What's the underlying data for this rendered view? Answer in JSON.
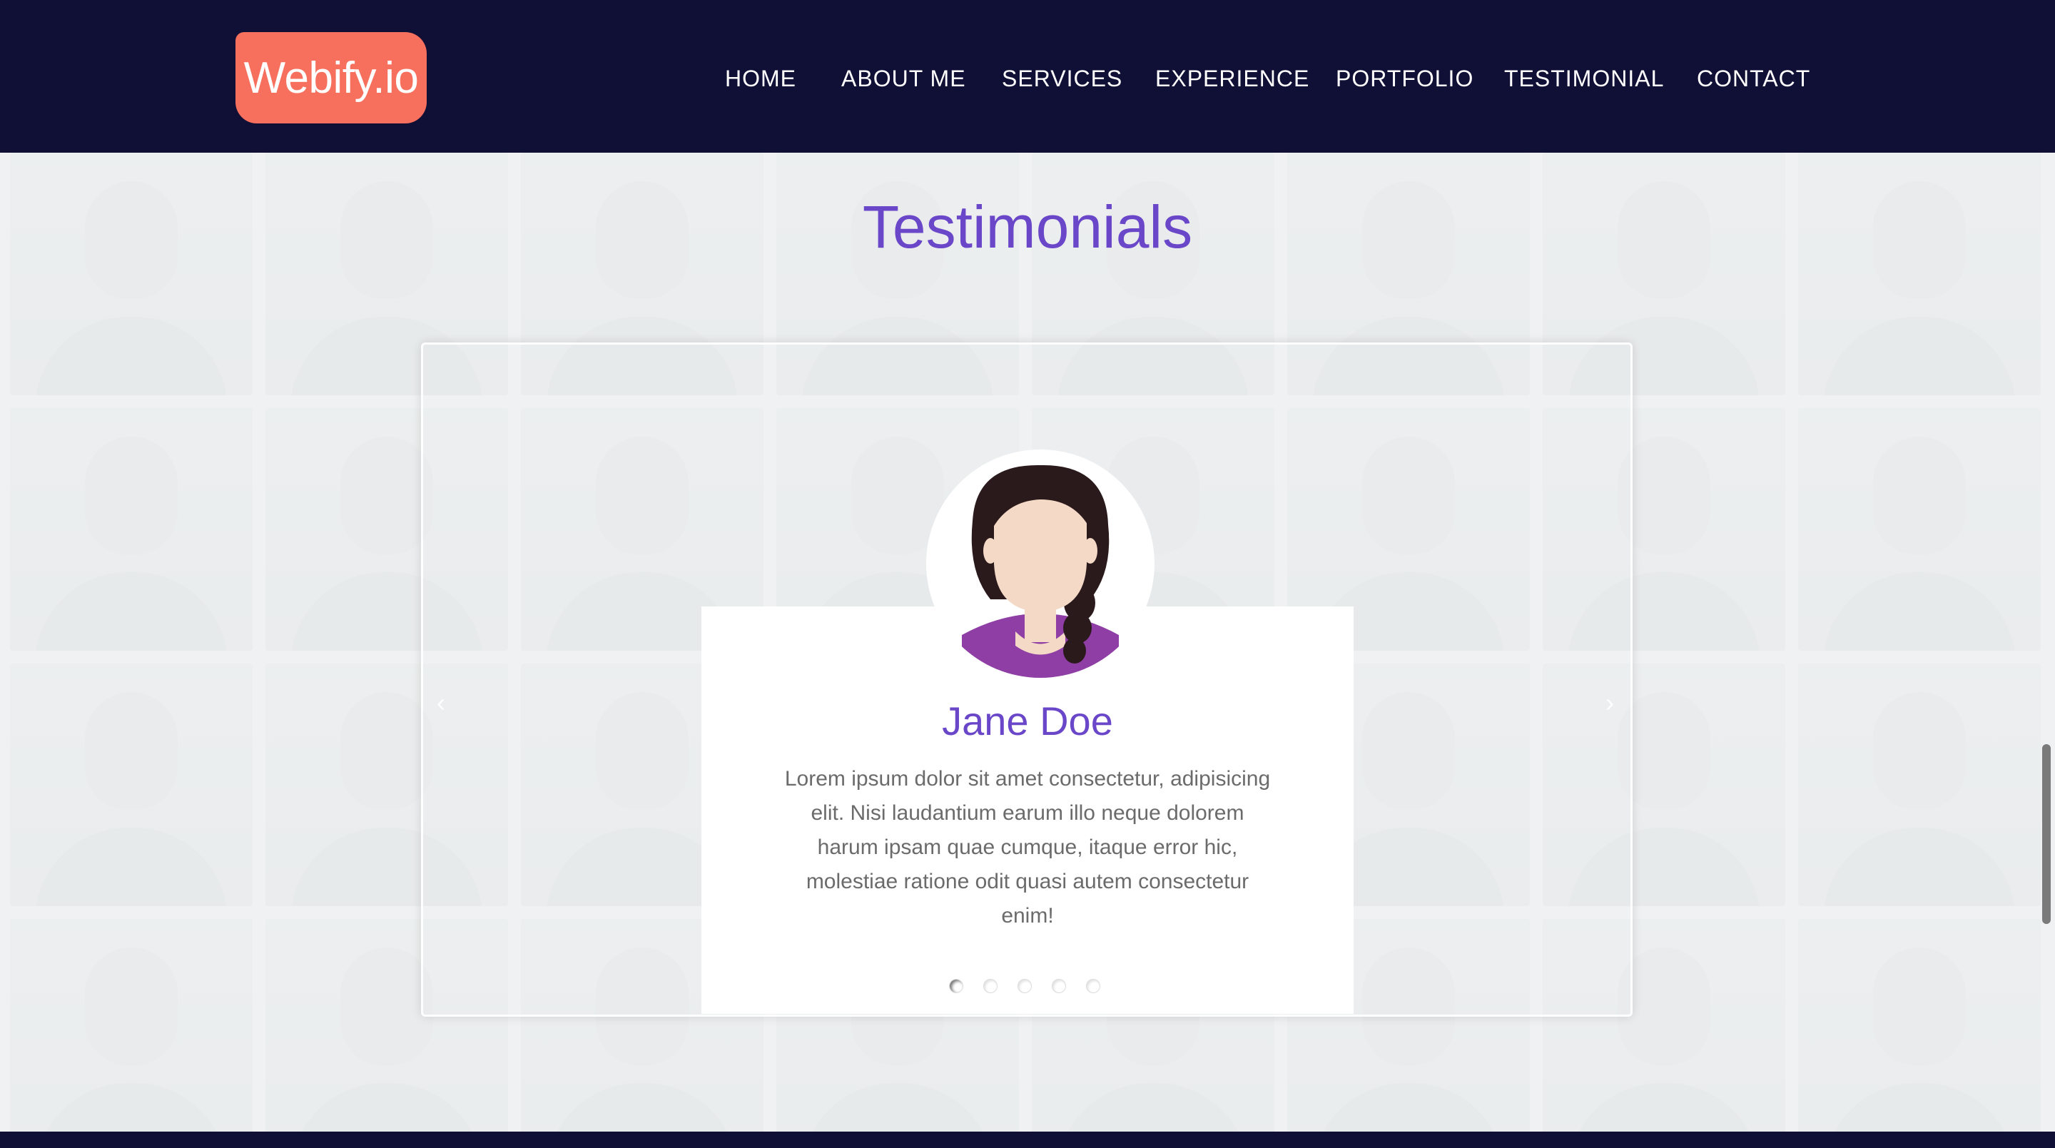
{
  "brand": {
    "logo_text": "Webify.io"
  },
  "nav": {
    "items": [
      {
        "label": "HOME"
      },
      {
        "label": "ABOUT ME"
      },
      {
        "label": "SERVICES"
      },
      {
        "label": "EXPERIENCE"
      },
      {
        "label": "PORTFOLIO"
      },
      {
        "label": "TESTIMONIAL"
      },
      {
        "label": "CONTACT"
      }
    ]
  },
  "testimonials": {
    "title": "Testimonials",
    "current": {
      "name": "Jane Doe",
      "quote": "Lorem ipsum dolor sit amet consectetur, adipisicing elit. Nisi laudantium earum illo neque dolorem harum ipsam quae cumque, itaque error hic, molestiae ratione odit quasi autem consectetur enim!",
      "avatar_icon": "female-avatar-icon"
    },
    "slide_count": 5,
    "active_slide": 1
  },
  "colors": {
    "navbar_bg": "#100f35",
    "logo_bg": "#f7705e",
    "accent_purple": "#6a46c9",
    "avatar_shirt": "#8e3ea4",
    "avatar_hair": "#2b1a1c",
    "avatar_skin": "#f3d9c6"
  }
}
